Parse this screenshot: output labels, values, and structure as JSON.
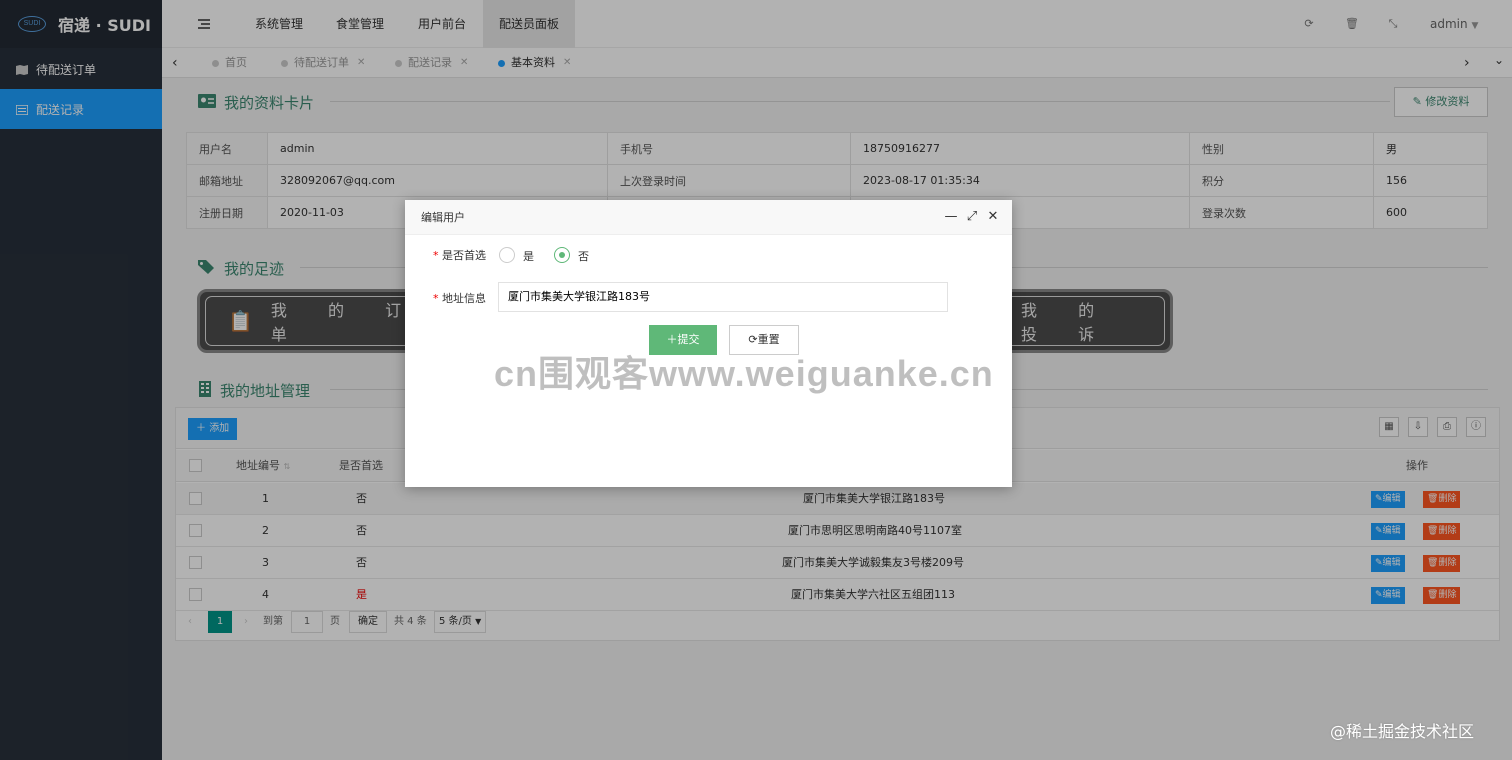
{
  "app": {
    "logo_mark": "SUDI",
    "title": "宿递 · SUDI"
  },
  "sidebar": {
    "items": [
      {
        "label": "待配送订单",
        "icon": "map-icon",
        "active": false
      },
      {
        "label": "配送记录",
        "icon": "list-icon",
        "active": true
      }
    ]
  },
  "header": {
    "menus": [
      "系统管理",
      "食堂管理",
      "用户前台",
      "配送员面板"
    ],
    "active_menu": "配送员面板",
    "user": "admin"
  },
  "tabs": [
    {
      "label": "首页",
      "closable": false
    },
    {
      "label": "待配送订单",
      "closable": true
    },
    {
      "label": "配送记录",
      "closable": true
    },
    {
      "label": "基本资料",
      "closable": true,
      "active": true
    }
  ],
  "profile": {
    "section_title": "我的资料卡片",
    "edit_button": "修改资料",
    "rows": [
      [
        {
          "k": "用户名",
          "v": "admin"
        },
        {
          "k": "手机号",
          "v": "18750916277"
        },
        {
          "k": "性别",
          "v": "男"
        }
      ],
      [
        {
          "k": "邮箱地址",
          "v": "328092067@qq.com"
        },
        {
          "k": "上次登录时间",
          "v": "2023-08-17 01:35:34"
        },
        {
          "k": "积分",
          "v": "156"
        }
      ],
      [
        {
          "k": "注册日期",
          "v": "2020-11-03"
        },
        {
          "k": "",
          "v": ""
        },
        {
          "k": "登录次数",
          "v": "600"
        }
      ]
    ]
  },
  "footprint": {
    "section_title": "我的足迹",
    "orders_label": "我 的 订 单",
    "complaints_label": "我 的 投 诉"
  },
  "addresses": {
    "section_title": "我的地址管理",
    "add_button": "添加",
    "headers": {
      "id": "地址编号",
      "preferred": "是否首选",
      "actions": "操作"
    },
    "rows": [
      {
        "id": "1",
        "preferred": "否",
        "address": "厦门市集美大学银江路183号"
      },
      {
        "id": "2",
        "preferred": "否",
        "address": "厦门市思明区思明南路40号1107室"
      },
      {
        "id": "3",
        "preferred": "否",
        "address": "厦门市集美大学诚毅集友3号楼209号"
      },
      {
        "id": "4",
        "preferred": "是",
        "address": "厦门市集美大学六社区五组团113"
      }
    ],
    "edit_label": "编辑",
    "delete_label": "删除",
    "pager": {
      "current": "1",
      "goto": "到第",
      "page_input": "1",
      "page": "页",
      "confirm": "确定",
      "total": "共 4 条",
      "per_page": "5 条/页"
    }
  },
  "dialog": {
    "title": "编辑用户",
    "preferred_label": "是否首选",
    "option_yes": "是",
    "option_no": "否",
    "selected": "否",
    "address_label": "地址信息",
    "address_value": "厦门市集美大学银江路183号",
    "submit": "提交",
    "reset": "重置"
  },
  "watermarks": {
    "main": "cn围观客www.weiguanke.cn",
    "corner": "@稀土掘金技术社区"
  },
  "colors": {
    "sidebar": "#28303b",
    "active": "#1e9fff",
    "green": "#5fb878",
    "danger": "#ff5722",
    "section": "#3c8770"
  }
}
